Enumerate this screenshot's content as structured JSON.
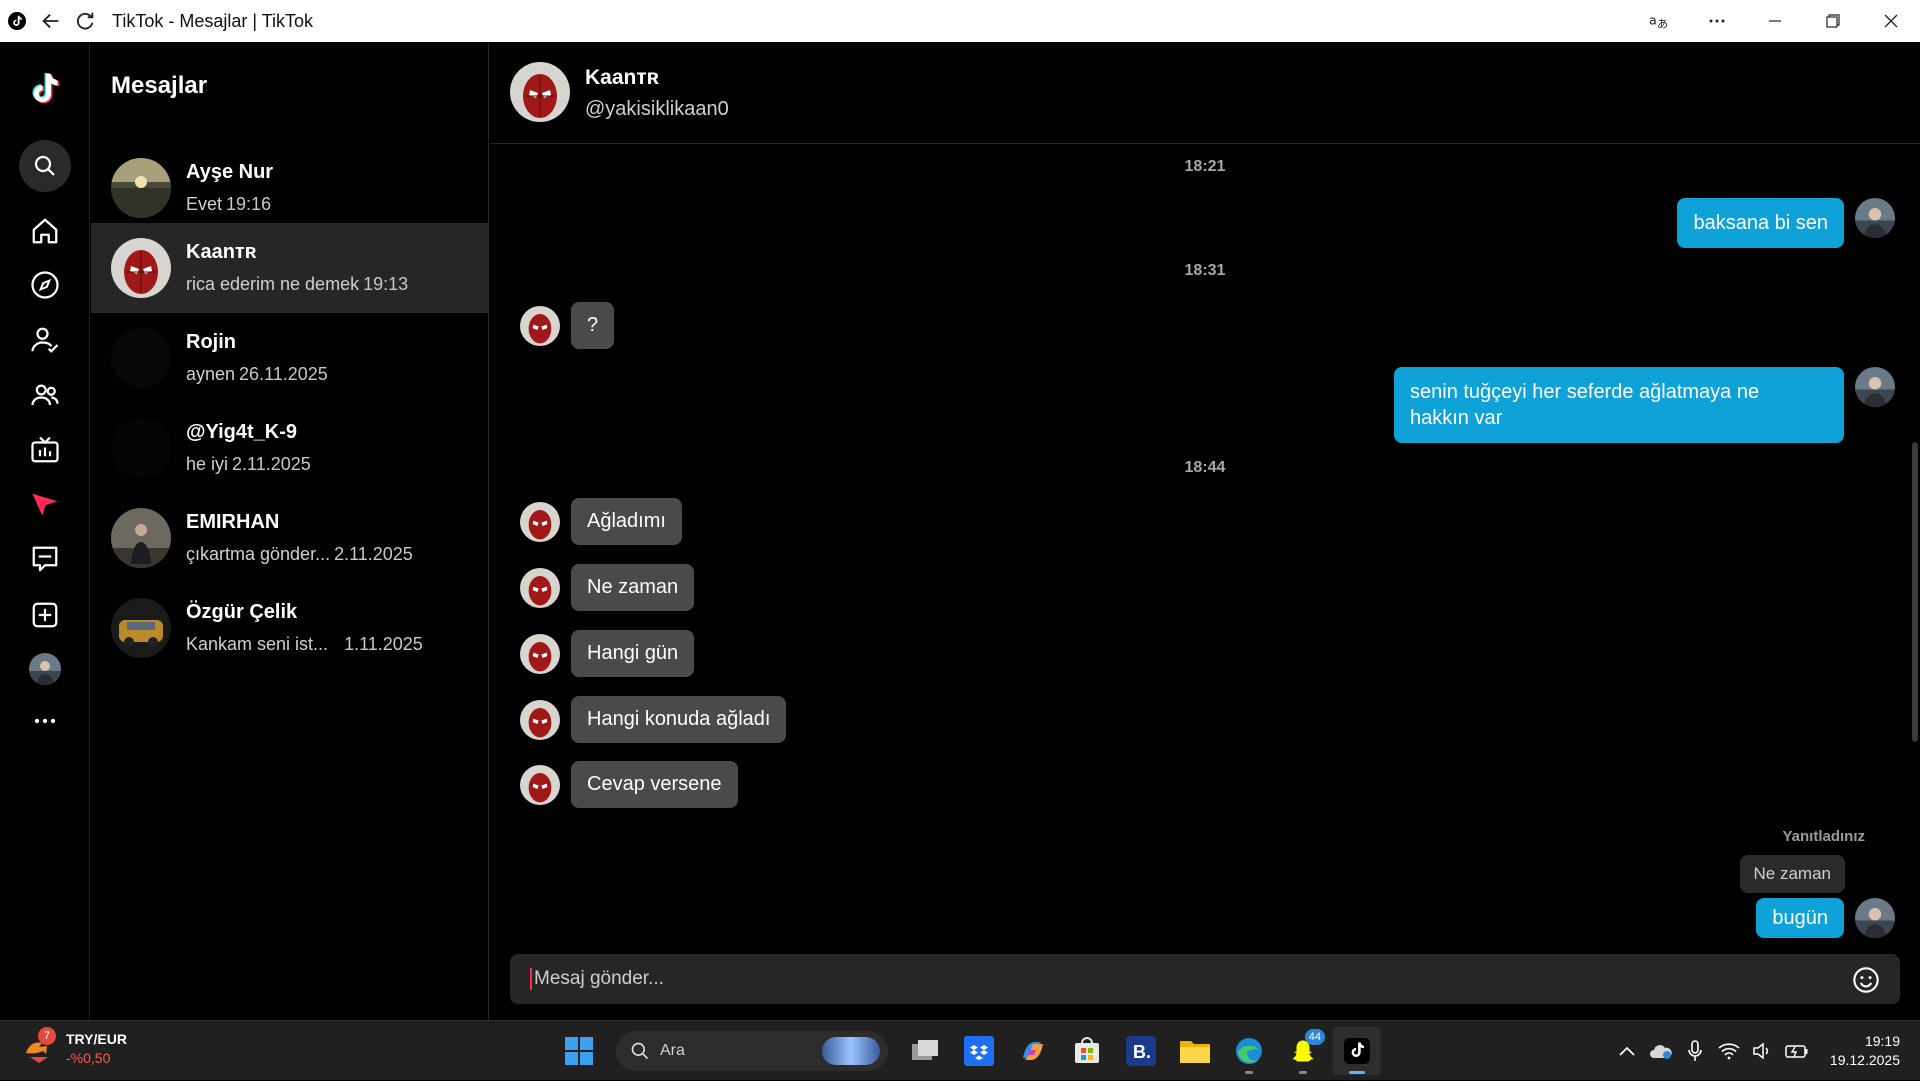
{
  "window": {
    "title": "TikTok - Mesajlar | TikTok"
  },
  "convlist": {
    "heading": "Mesajlar",
    "items": [
      {
        "name": "Ayşe Nur",
        "preview": "Evet",
        "time": "19:16"
      },
      {
        "name": "Kaanᴛʀ",
        "preview": "rica ederim ne demek",
        "time": "19:13"
      },
      {
        "name": "Rojin",
        "preview": "aynen",
        "time": "26.11.2025"
      },
      {
        "name": "@Yig4t_K-9",
        "preview": "he iyi",
        "time": "2.11.2025"
      },
      {
        "name": "EMIRHAN",
        "preview": "çıkartma gönder...",
        "time": "2.11.2025"
      },
      {
        "name": "Özgür Çelik",
        "preview": "Kankam seni ist...",
        "time": "1.11.2025"
      }
    ]
  },
  "chat": {
    "name": "Kaanᴛʀ",
    "handle": "@yakisiklikaan0",
    "stamps": [
      "18:21",
      "18:31",
      "18:44"
    ],
    "out1": "baksana bi sen",
    "in1": "?",
    "out2_line1": "senin tuğçeyi her seferde ağlatmaya ne",
    "out2_line2": "hakkın var",
    "in2": "Ağladımı",
    "in3": "Ne zaman",
    "in4": "Hangi gün",
    "in5": "Hangi konuda ağladı",
    "in6": "Cevap versene",
    "reply_label": "Yanıtladınız",
    "reply_quote": "Ne zaman",
    "out3": "bugün",
    "composer_placeholder": "Mesaj gönder..."
  },
  "taskbar": {
    "weather_badge": "7",
    "ticker": "TRY/EUR",
    "change": "-%0,50",
    "search_label": "Ara",
    "notif_badge": "44",
    "time": "19:19",
    "date": "19.12.2025"
  },
  "colors": {
    "accent_blue": "#0fa2d8",
    "bubble_gray": "#4a4a4a",
    "tiktok_red": "#fe2c55",
    "tiktok_cyan": "#25f4ee"
  }
}
